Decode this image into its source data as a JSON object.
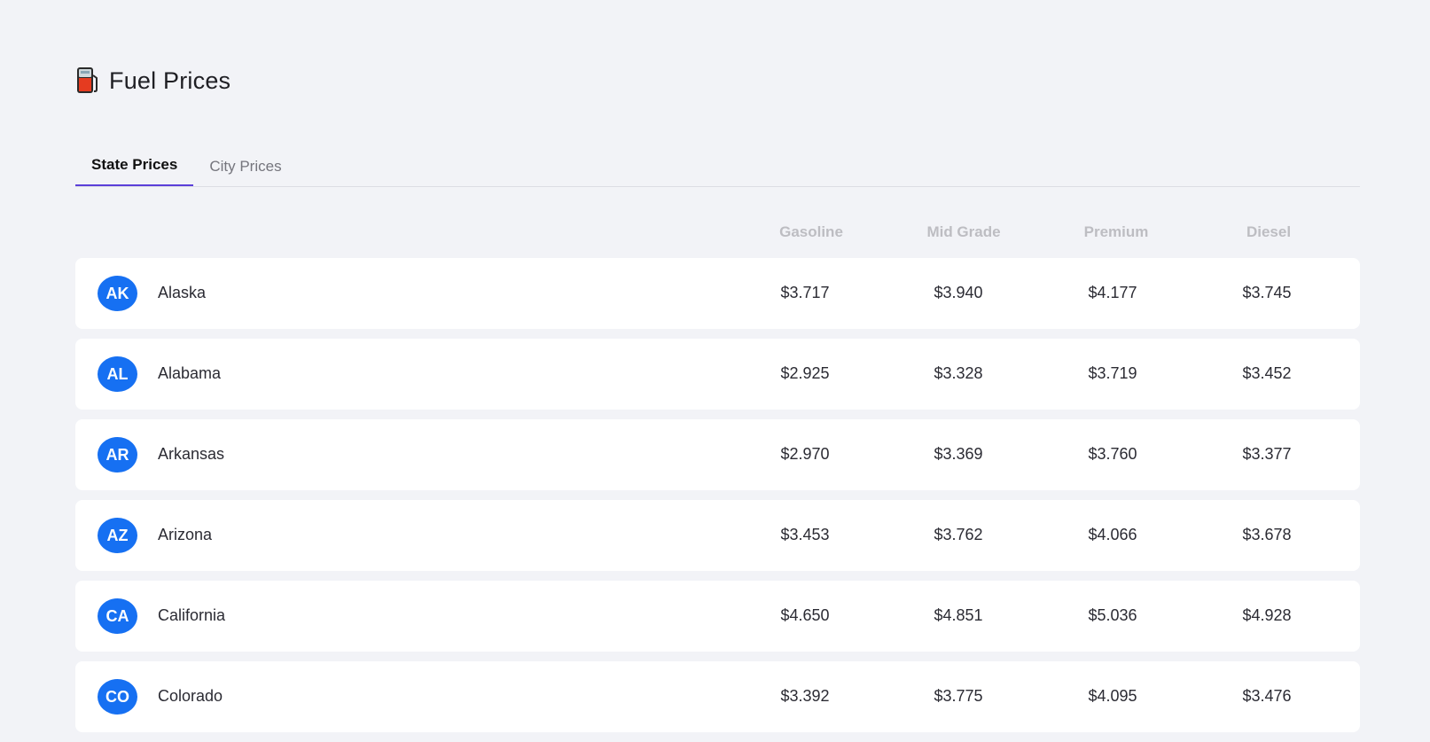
{
  "header": {
    "title": "Fuel Prices",
    "icon": "fuel-pump-icon"
  },
  "tabs": [
    {
      "label": "State Prices",
      "active": true
    },
    {
      "label": "City Prices",
      "active": false
    }
  ],
  "columns": [
    "Gasoline",
    "Mid Grade",
    "Premium",
    "Diesel"
  ],
  "rows": [
    {
      "code": "AK",
      "name": "Alaska",
      "gasoline": "$3.717",
      "mid_grade": "$3.940",
      "premium": "$4.177",
      "diesel": "$3.745"
    },
    {
      "code": "AL",
      "name": "Alabama",
      "gasoline": "$2.925",
      "mid_grade": "$3.328",
      "premium": "$3.719",
      "diesel": "$3.452"
    },
    {
      "code": "AR",
      "name": "Arkansas",
      "gasoline": "$2.970",
      "mid_grade": "$3.369",
      "premium": "$3.760",
      "diesel": "$3.377"
    },
    {
      "code": "AZ",
      "name": "Arizona",
      "gasoline": "$3.453",
      "mid_grade": "$3.762",
      "premium": "$4.066",
      "diesel": "$3.678"
    },
    {
      "code": "CA",
      "name": "California",
      "gasoline": "$4.650",
      "mid_grade": "$4.851",
      "premium": "$5.036",
      "diesel": "$4.928"
    },
    {
      "code": "CO",
      "name": "Colorado",
      "gasoline": "$3.392",
      "mid_grade": "$3.775",
      "premium": "$4.095",
      "diesel": "$3.476"
    }
  ],
  "colors": {
    "accent": "#5b3fd9",
    "avatar": "#1670f2",
    "background": "#f2f3f7"
  }
}
